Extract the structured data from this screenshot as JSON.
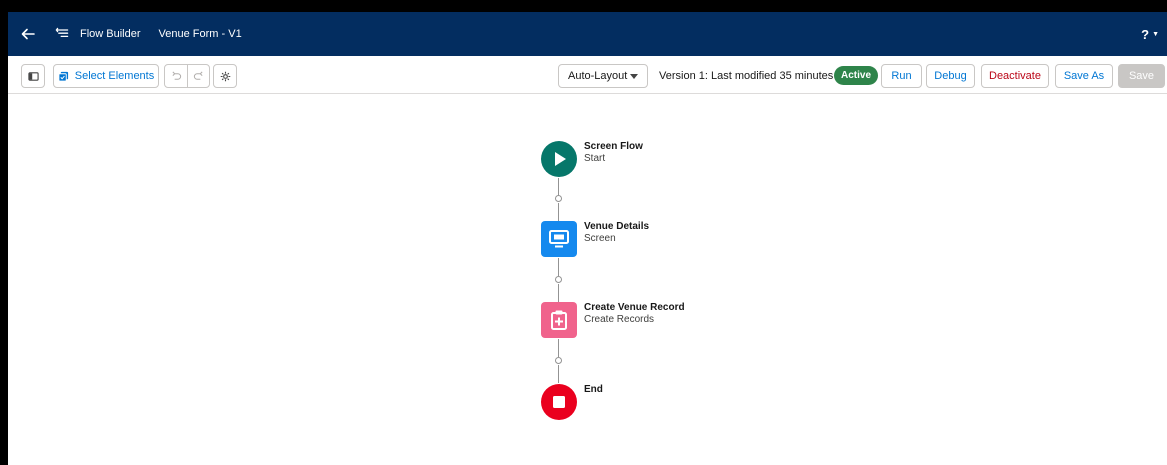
{
  "header": {
    "app_name": "Flow Builder",
    "flow_name": "Venue Form - V1",
    "help_label": "?"
  },
  "toolbar": {
    "select_elements_label": "Select Elements",
    "layout_label": "Auto-Layout",
    "version_text": "Version 1: Last modified 35 minutes ago",
    "status_badge": "Active",
    "run_label": "Run",
    "debug_label": "Debug",
    "deactivate_label": "Deactivate",
    "save_as_label": "Save As",
    "save_label": "Save"
  },
  "flow": {
    "nodes": [
      {
        "title": "Screen Flow",
        "subtitle": "Start",
        "icon": "play-icon",
        "color": "#06776a"
      },
      {
        "title": "Venue Details",
        "subtitle": "Screen",
        "icon": "screen-icon",
        "color": "#1589ee"
      },
      {
        "title": "Create Venue Record",
        "subtitle": "Create Records",
        "icon": "clipboard-add-icon",
        "color": "#f0638c"
      },
      {
        "title": "End",
        "subtitle": "",
        "icon": "stop-icon",
        "color": "#ea001e"
      }
    ]
  },
  "colors": {
    "header_bg": "#032d60",
    "brand_blue": "#0176d3",
    "active_green": "#2e844a",
    "deactivate_red": "#ba0517"
  }
}
